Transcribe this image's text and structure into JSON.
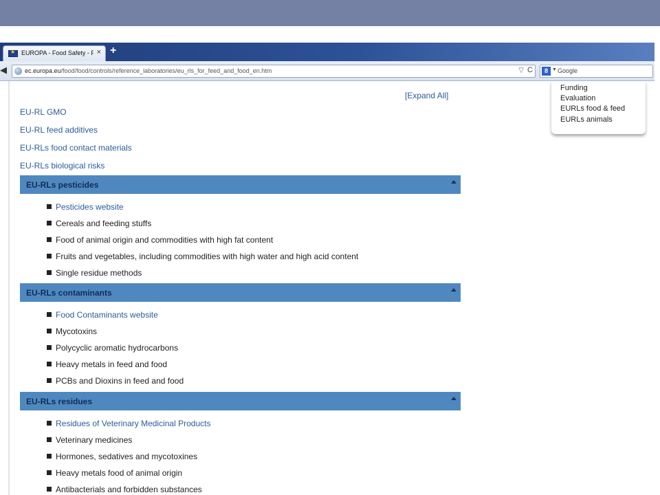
{
  "browser": {
    "tab_title": "EUROPA - Food Safety - Foo...",
    "tab_close": "×",
    "new_tab": "+",
    "url_domain": "ec.europa.eu",
    "url_path": "/food/food/controls/reference_laboratories/eu_rls_for_feed_and_food_en.htm",
    "url_star": "▽",
    "url_reload": "C",
    "search_engine_letter": "8",
    "search_placeholder": "Google"
  },
  "dropdown_menu": {
    "items": [
      "Funding",
      "Evaluation",
      "EURLs food & feed",
      "EURLs animals"
    ]
  },
  "page": {
    "expand_all": "[Expand All]",
    "top_links": [
      "EU-RL GMO",
      "EU-RL feed additives",
      "EU-RLs food contact materials",
      "EU-RLs biological risks"
    ],
    "sections": [
      {
        "title": "EU-RLs pesticides",
        "items": [
          {
            "text": "Pesticides website",
            "link": true
          },
          {
            "text": "Cereals and feeding stuffs",
            "link": false
          },
          {
            "text": "Food of animal origin and commodities with high fat content",
            "link": false
          },
          {
            "text": "Fruits and vegetables, including commodities with high water and high acid content",
            "link": false
          },
          {
            "text": "Single residue methods",
            "link": false
          }
        ]
      },
      {
        "title": "EU-RLs contaminants",
        "items": [
          {
            "text": "Food Contaminants website",
            "link": true
          },
          {
            "text": "Mycotoxins",
            "link": false
          },
          {
            "text": "Polycyclic aromatic hydrocarbons",
            "link": false
          },
          {
            "text": "Heavy metals in feed and food",
            "link": false
          },
          {
            "text": "PCBs and Dioxins in feed and food",
            "link": false
          }
        ]
      },
      {
        "title": "EU-RLs residues",
        "items": [
          {
            "text": "Residues of Veterinary Medicinal Products",
            "link": true
          },
          {
            "text": "Veterinary medicines",
            "link": false
          },
          {
            "text": "Hormones, sedatives and mycotoxines",
            "link": false
          },
          {
            "text": "Heavy metals food of animal origin",
            "link": false
          },
          {
            "text": "Antibacterials and forbidden substances",
            "link": false
          }
        ]
      }
    ]
  },
  "colors": {
    "slide_band": "#7580a5",
    "section_header": "#4f88bf",
    "link": "#2a5c9a"
  }
}
